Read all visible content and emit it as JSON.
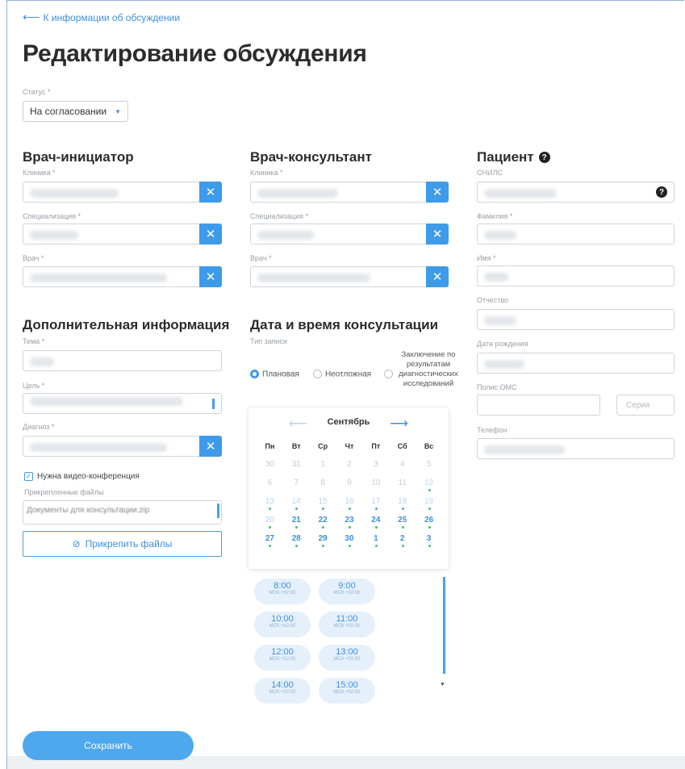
{
  "header": {
    "back_link": "К информации об обсуждении",
    "title": "Редактирование обсуждения"
  },
  "status": {
    "label": "Статус *",
    "value": "На согласовании"
  },
  "initiator": {
    "title": "Врач-инициатор",
    "clinic_label": "Клиника *",
    "specialization_label": "Специализация *",
    "doctor_label": "Врач *"
  },
  "consultant": {
    "title": "Врач-консультант",
    "clinic_label": "Клиника *",
    "specialization_label": "Специализация *",
    "doctor_label": "Врач *"
  },
  "patient": {
    "title": "Пациент",
    "snils_label": "СНИЛС",
    "lastname_label": "Фамилия *",
    "firstname_label": "Имя *",
    "middlename_label": "Отчество",
    "birthdate_label": "Дата рождения",
    "oms_label": "Полис ОМС",
    "series_placeholder": "Серия",
    "phone_label": "Телефон"
  },
  "additional": {
    "title": "Дополнительная информация",
    "topic_label": "Тема *",
    "goal_label": "Цель *",
    "diagnosis_label": "Диагноз *",
    "video_label": "Нужна видео-конференция",
    "video_checked": true,
    "files_label": "Прикрепленные файлы",
    "files_text": "Документы для консультации.zip",
    "attach_button": "Прикрепить файлы"
  },
  "consultation": {
    "title": "Дата и время консультации",
    "record_type_label": "Тип записи",
    "options": [
      "Плановая",
      "Неотложная",
      "Заключение по результатам диагностических исследований"
    ],
    "selected_option": "Плановая",
    "calendar": {
      "month": "Сентябрь",
      "weekdays": [
        "Пн",
        "Вт",
        "Ср",
        "Чт",
        "Пт",
        "Сб",
        "Вс"
      ],
      "days": [
        "30",
        "31",
        "1",
        "2",
        "3",
        "4",
        "5",
        "6",
        "7",
        "8",
        "9",
        "10",
        "11",
        "12",
        "13",
        "14",
        "15",
        "16",
        "17",
        "18",
        "19",
        "20",
        "21",
        "22",
        "23",
        "24",
        "25",
        "26",
        "27",
        "28",
        "29",
        "30",
        "1",
        "2",
        "3"
      ],
      "selected_day": "13"
    },
    "slots": [
      {
        "time": "8:00",
        "zone": "МСК +02:00"
      },
      {
        "time": "9:00",
        "zone": "МСК +02:00"
      },
      {
        "time": "10:00",
        "zone": "МСК +02:00"
      },
      {
        "time": "11:00",
        "zone": "МСК +02:00"
      },
      {
        "time": "12:00",
        "zone": "МСК +02:00"
      },
      {
        "time": "13:00",
        "zone": "МСК +02:00"
      },
      {
        "time": "14:00",
        "zone": "МСК +02:00"
      },
      {
        "time": "15:00",
        "zone": "МСК +02:00"
      }
    ]
  },
  "actions": {
    "save": "Сохранить"
  },
  "colors": {
    "accent": "#3d9be9",
    "available_dot": "#3ec46d"
  }
}
